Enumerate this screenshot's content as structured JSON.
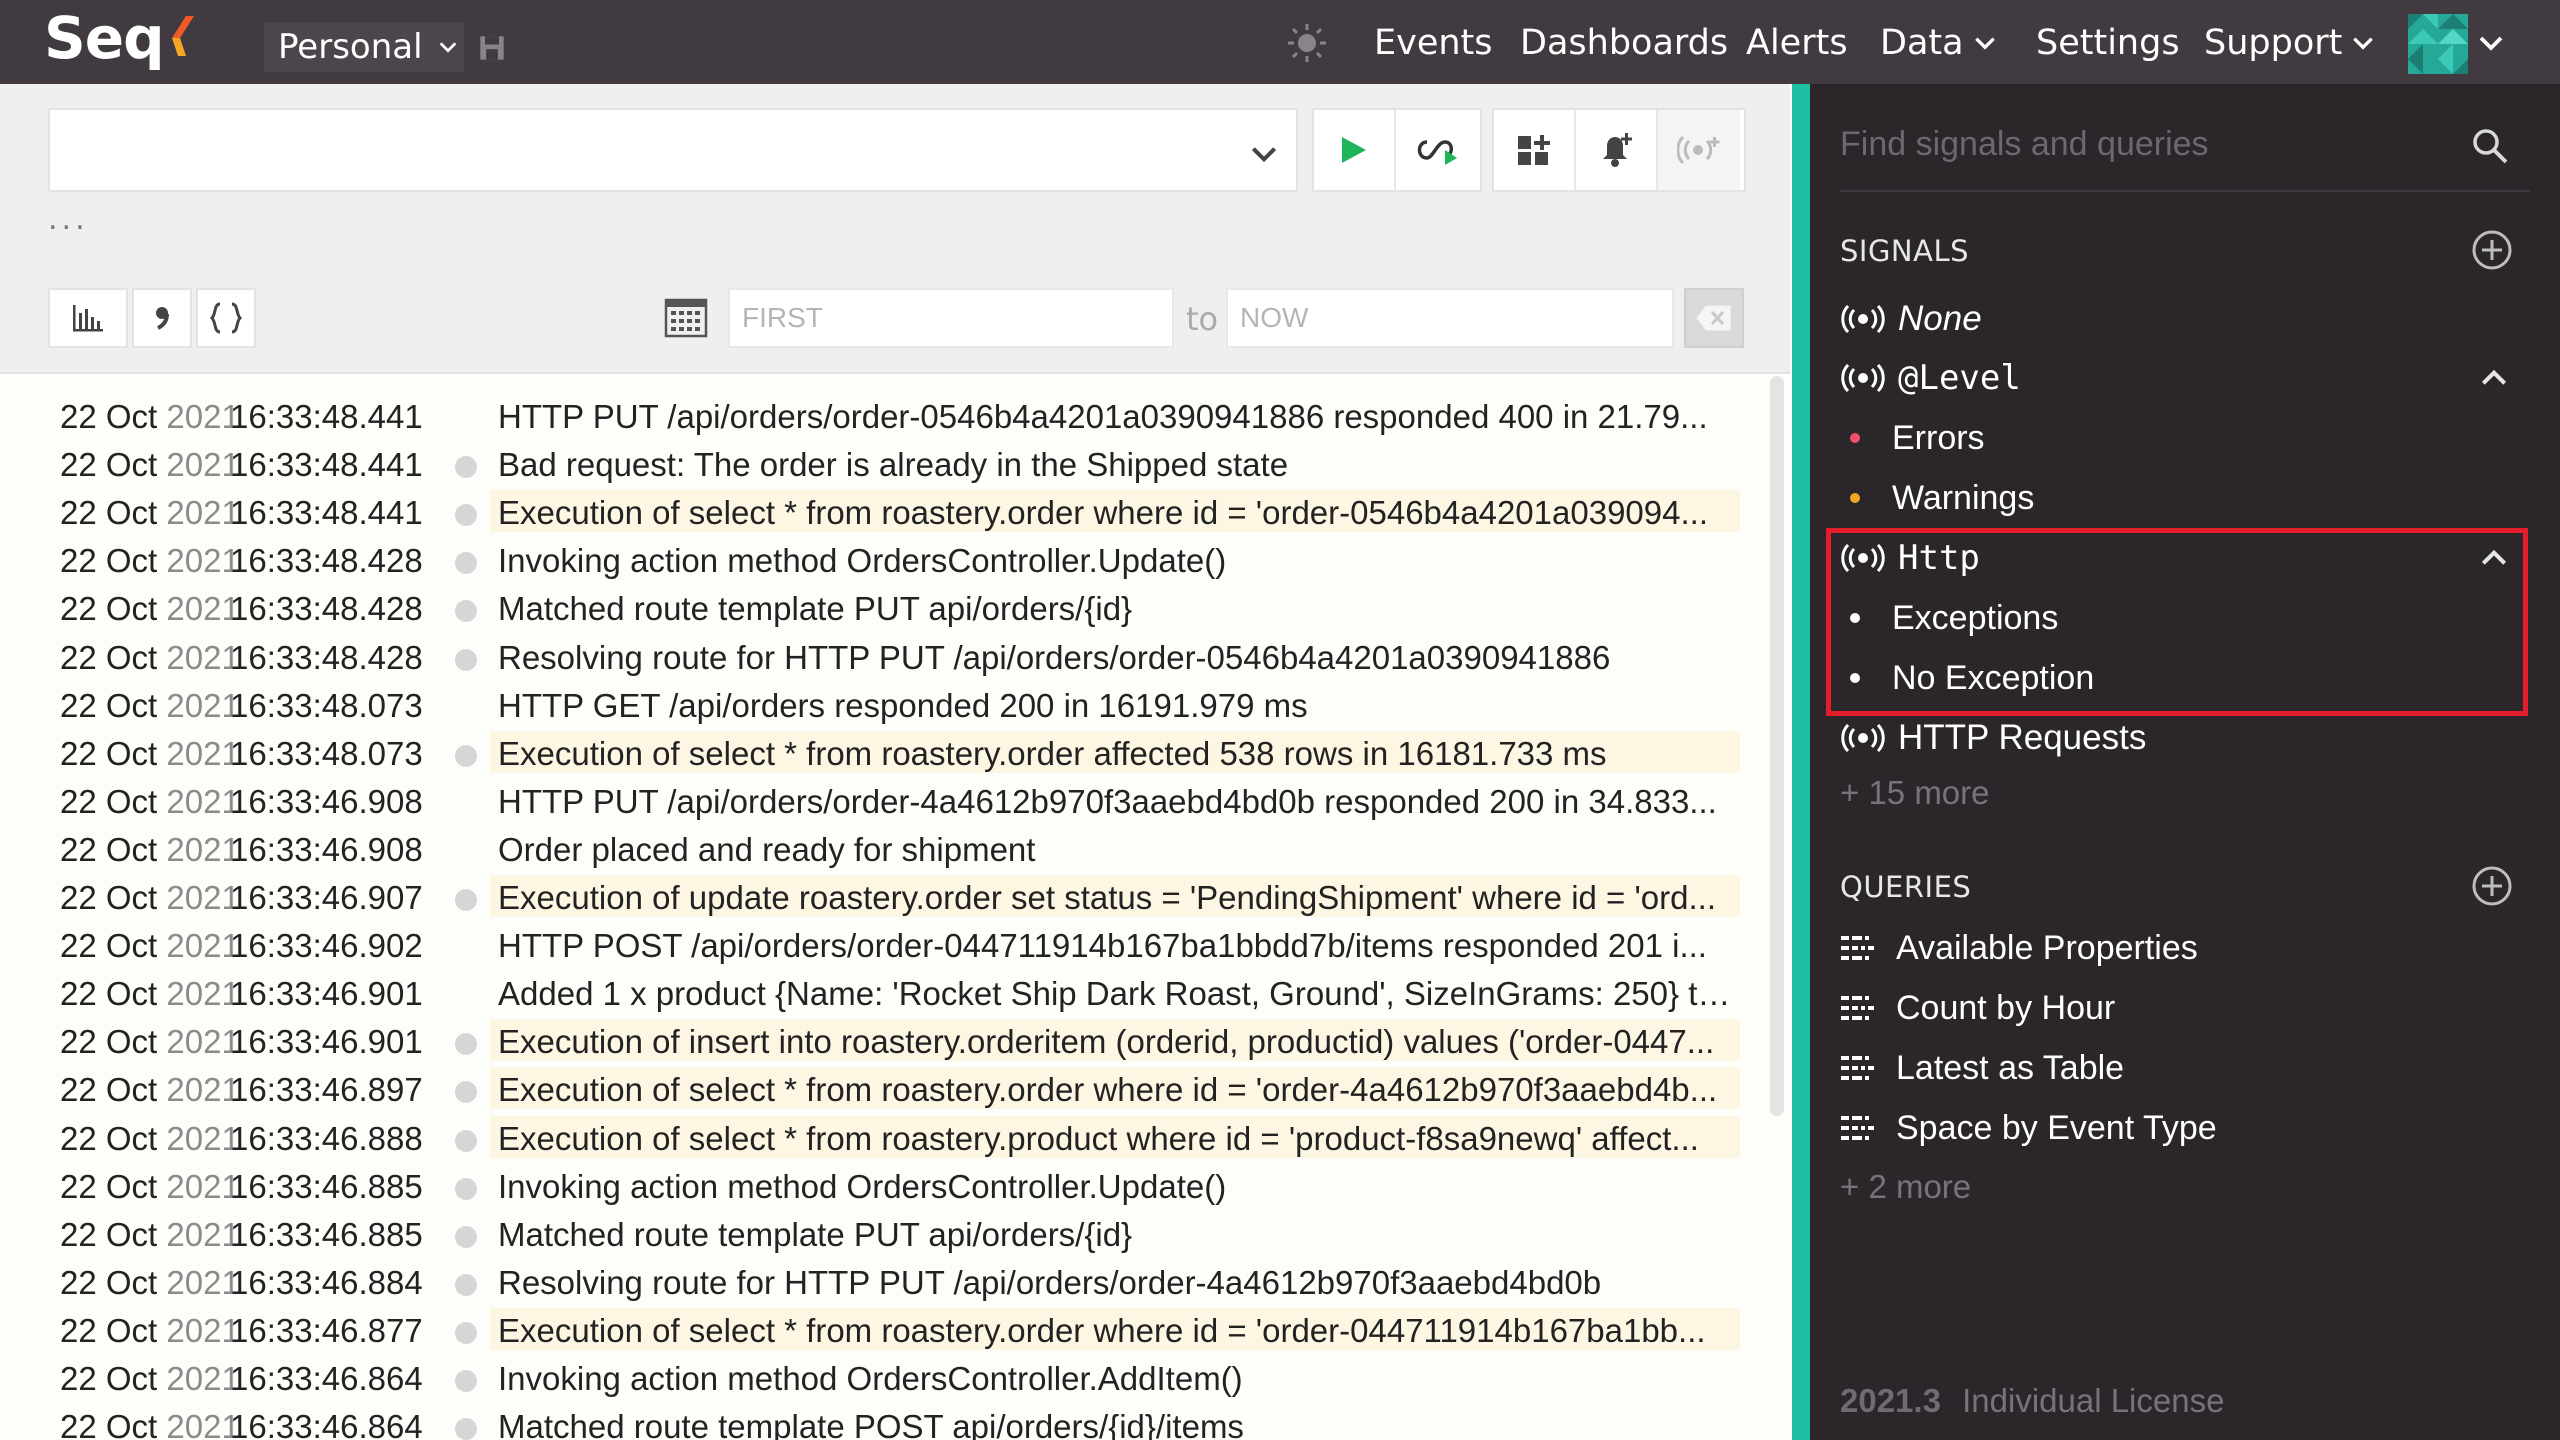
{
  "topnav": {
    "logo": "Seq",
    "workspace": "Personal",
    "items": [
      {
        "label": "Events"
      },
      {
        "label": "Dashboards"
      },
      {
        "label": "Alerts"
      },
      {
        "label": "Data"
      },
      {
        "label": "Settings"
      },
      {
        "label": "Support"
      }
    ]
  },
  "query": {
    "value": "",
    "ellipsis": "...",
    "date_from_placeholder": "FIRST",
    "date_to_placeholder": "NOW",
    "to_label": "to"
  },
  "events": [
    {
      "date": "22 Oct",
      "year": "2021",
      "time": "16:33:48.441",
      "dot": false,
      "hl": false,
      "msg": "HTTP PUT /api/orders/order-0546b4a4201a0390941886 responded 400 in 21.79..."
    },
    {
      "date": "22 Oct",
      "year": "2021",
      "time": "16:33:48.441",
      "dot": true,
      "hl": false,
      "msg": "Bad request: The order is already in the Shipped state"
    },
    {
      "date": "22 Oct",
      "year": "2021",
      "time": "16:33:48.441",
      "dot": true,
      "hl": true,
      "msg": "Execution of select * from roastery.order where id = 'order-0546b4a4201a039094..."
    },
    {
      "date": "22 Oct",
      "year": "2021",
      "time": "16:33:48.428",
      "dot": true,
      "hl": false,
      "msg": "Invoking action method OrdersController.Update()"
    },
    {
      "date": "22 Oct",
      "year": "2021",
      "time": "16:33:48.428",
      "dot": true,
      "hl": false,
      "msg": "Matched route template PUT api/orders/{id}"
    },
    {
      "date": "22 Oct",
      "year": "2021",
      "time": "16:33:48.428",
      "dot": true,
      "hl": false,
      "msg": "Resolving route for HTTP PUT /api/orders/order-0546b4a4201a0390941886"
    },
    {
      "date": "22 Oct",
      "year": "2021",
      "time": "16:33:48.073",
      "dot": false,
      "hl": false,
      "msg": "HTTP GET /api/orders responded 200 in 16191.979 ms"
    },
    {
      "date": "22 Oct",
      "year": "2021",
      "time": "16:33:48.073",
      "dot": true,
      "hl": true,
      "msg": "Execution of select * from roastery.order affected 538 rows in 16181.733 ms"
    },
    {
      "date": "22 Oct",
      "year": "2021",
      "time": "16:33:46.908",
      "dot": false,
      "hl": false,
      "msg": "HTTP PUT /api/orders/order-4a4612b970f3aaebd4bd0b responded 200 in 34.833..."
    },
    {
      "date": "22 Oct",
      "year": "2021",
      "time": "16:33:46.908",
      "dot": false,
      "hl": false,
      "msg": "Order placed and ready for shipment"
    },
    {
      "date": "22 Oct",
      "year": "2021",
      "time": "16:33:46.907",
      "dot": true,
      "hl": true,
      "msg": "Execution of update roastery.order set status = 'PendingShipment' where id = 'ord..."
    },
    {
      "date": "22 Oct",
      "year": "2021",
      "time": "16:33:46.902",
      "dot": false,
      "hl": false,
      "msg": "HTTP POST /api/orders/order-044711914b167ba1bbdd7b/items responded 201 i..."
    },
    {
      "date": "22 Oct",
      "year": "2021",
      "time": "16:33:46.901",
      "dot": false,
      "hl": false,
      "msg": "Added 1 x product {Name: 'Rocket Ship Dark Roast, Ground', SizeInGrams: 250} to ..."
    },
    {
      "date": "22 Oct",
      "year": "2021",
      "time": "16:33:46.901",
      "dot": true,
      "hl": true,
      "msg": "Execution of insert into roastery.orderitem (orderid, productid) values ('order-0447..."
    },
    {
      "date": "22 Oct",
      "year": "2021",
      "time": "16:33:46.897",
      "dot": true,
      "hl": true,
      "msg": "Execution of select * from roastery.order where id = 'order-4a4612b970f3aaebd4b..."
    },
    {
      "date": "22 Oct",
      "year": "2021",
      "time": "16:33:46.888",
      "dot": true,
      "hl": true,
      "msg": "Execution of select * from roastery.product where id = 'product-f8sa9newq' affect..."
    },
    {
      "date": "22 Oct",
      "year": "2021",
      "time": "16:33:46.885",
      "dot": true,
      "hl": false,
      "msg": "Invoking action method OrdersController.Update()"
    },
    {
      "date": "22 Oct",
      "year": "2021",
      "time": "16:33:46.885",
      "dot": true,
      "hl": false,
      "msg": "Matched route template PUT api/orders/{id}"
    },
    {
      "date": "22 Oct",
      "year": "2021",
      "time": "16:33:46.884",
      "dot": true,
      "hl": false,
      "msg": "Resolving route for HTTP PUT /api/orders/order-4a4612b970f3aaebd4bd0b"
    },
    {
      "date": "22 Oct",
      "year": "2021",
      "time": "16:33:46.877",
      "dot": true,
      "hl": true,
      "msg": "Execution of select * from roastery.order where id = 'order-044711914b167ba1bb..."
    },
    {
      "date": "22 Oct",
      "year": "2021",
      "time": "16:33:46.864",
      "dot": true,
      "hl": false,
      "msg": "Invoking action method OrdersController.AddItem()"
    },
    {
      "date": "22 Oct",
      "year": "2021",
      "time": "16:33:46.864",
      "dot": true,
      "hl": false,
      "msg": "Matched route template POST api/orders/{id}/items"
    }
  ],
  "sidebar": {
    "find_placeholder": "Find signals and queries",
    "signals_title": "SIGNALS",
    "queries_title": "QUERIES",
    "signals": {
      "none": "None",
      "level": "@Level",
      "errors": "Errors",
      "warnings": "Warnings",
      "http": "Http",
      "exceptions": "Exceptions",
      "no_exception": "No Exception",
      "http_requests": "HTTP Requests",
      "more": "+ 15 more"
    },
    "queries": [
      {
        "label": "Available Properties"
      },
      {
        "label": "Count by Hour"
      },
      {
        "label": "Latest as Table"
      },
      {
        "label": "Space by Event Type"
      }
    ],
    "queries_more": "+ 2 more",
    "version": "2021.3",
    "license": "Individual License"
  },
  "colors": {
    "accent": "#1ebfa4",
    "error_bullet": "#f0506e",
    "warning_bullet": "#f5a623",
    "highlight_border": "#e31d2b",
    "run_green": "#1fb65a"
  }
}
